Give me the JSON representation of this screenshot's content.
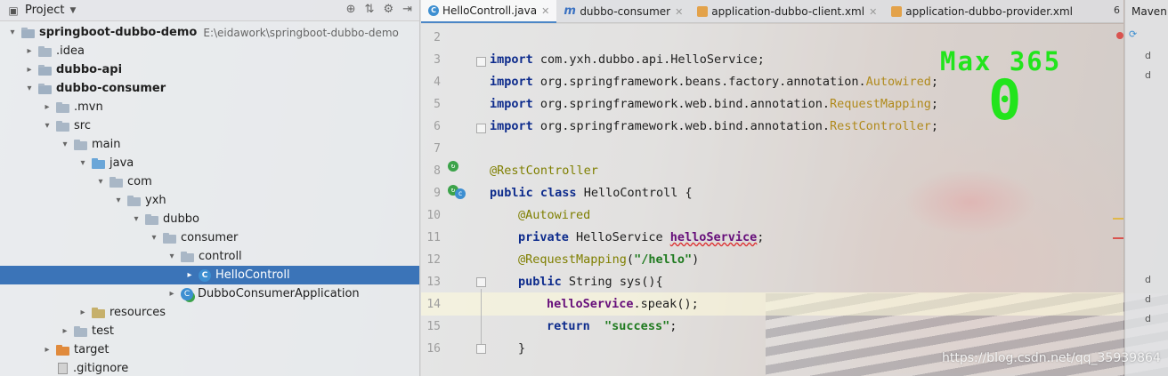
{
  "project_panel": {
    "title": "Project",
    "tree": [
      {
        "label": "springboot-dubbo-demo",
        "path": "E:\\eidawork\\springboot-dubbo-demo"
      },
      {
        "label": ".idea"
      },
      {
        "label": "dubbo-api"
      },
      {
        "label": "dubbo-consumer"
      },
      {
        "label": ".mvn"
      },
      {
        "label": "src"
      },
      {
        "label": "main"
      },
      {
        "label": "java"
      },
      {
        "label": "com"
      },
      {
        "label": "yxh"
      },
      {
        "label": "dubbo"
      },
      {
        "label": "consumer"
      },
      {
        "label": "controll"
      },
      {
        "label": "HelloControll"
      },
      {
        "label": "DubboConsumerApplication"
      },
      {
        "label": "resources"
      },
      {
        "label": "test"
      },
      {
        "label": "target"
      },
      {
        "label": ".gitignore"
      }
    ]
  },
  "tabs": [
    {
      "label": "HelloControll.java"
    },
    {
      "label": "dubbo-consumer"
    },
    {
      "label": "application-dubbo-client.xml"
    },
    {
      "label": "application-dubbo-provider.xml"
    }
  ],
  "tab_overflow_count": "6",
  "editor": {
    "line_numbers": [
      "2",
      "3",
      "4",
      "5",
      "6",
      "7",
      "8",
      "9",
      "10",
      "11",
      "12",
      "13",
      "14",
      "15",
      "16"
    ],
    "line3": {
      "kw": "import",
      "rest": "com.yxh.dubbo.api.HelloService;"
    },
    "line4": {
      "kw": "import",
      "pkg": "org.springframework.beans.factory.annotation.",
      "cls": "Autowired",
      "semi": ";"
    },
    "line5": {
      "kw": "import",
      "pkg": "org.springframework.web.bind.annotation.",
      "cls": "RequestMapping",
      "semi": ";"
    },
    "line6": {
      "kw": "import",
      "pkg": "org.springframework.web.bind.annotation.",
      "cls": "RestController",
      "semi": ";"
    },
    "line8": {
      "ann": "@RestController"
    },
    "line9": {
      "kw1": "public",
      "kw2": "class",
      "rest": "HelloControll {"
    },
    "line10": {
      "ann": "@Autowired"
    },
    "line11": {
      "kw": "private",
      "type": "HelloService",
      "field": "helloService",
      "semi": ";"
    },
    "line12": {
      "ann": "@RequestMapping",
      "open": "(",
      "str": "\"/hello\"",
      "close": ")"
    },
    "line13": {
      "kw": "public",
      "rest": "String sys(){"
    },
    "line14": {
      "field": "helloService",
      "rest": ".speak();"
    },
    "line15": {
      "kw": "return",
      "str": "\"success\"",
      "semi": ";"
    },
    "line16": {
      "rest": "}"
    }
  },
  "overlay": {
    "max_label": "Max 365",
    "value": "0"
  },
  "maven_panel": {
    "title": "Maven",
    "rows": [
      "d",
      "d",
      "d",
      "d",
      "d"
    ]
  },
  "watermark": "https://blog.csdn.net/qq_35939864",
  "colors": {
    "selection": "#3b74b8",
    "overlay_green": "#22e41c",
    "keyword": "#0d2b8c",
    "field": "#660e7a",
    "string": "#1f7a1f"
  }
}
